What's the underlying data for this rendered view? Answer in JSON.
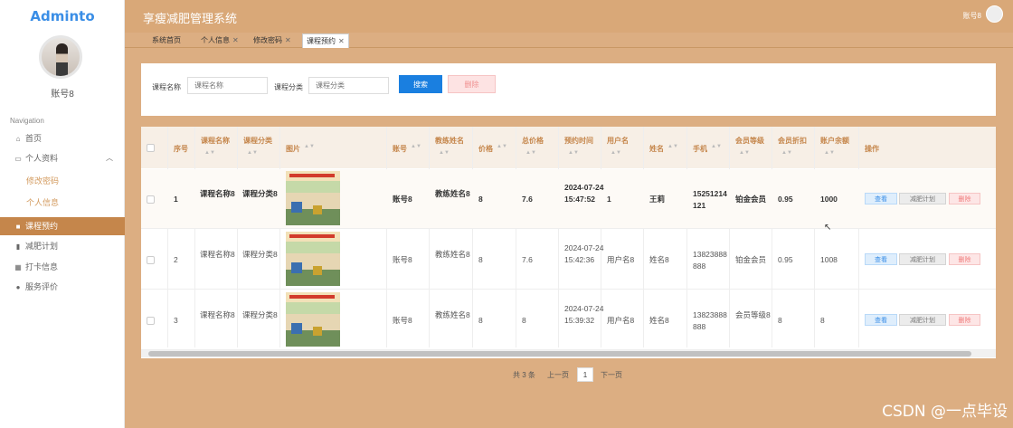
{
  "sidebar": {
    "logo": "Adminto",
    "username": "账号8",
    "nav_title": "Navigation",
    "items": [
      {
        "label": "首页",
        "icon": "home-icon"
      },
      {
        "label": "个人资料",
        "icon": "profile-icon"
      },
      {
        "label": "修改密码"
      },
      {
        "label": "个人信息"
      },
      {
        "label": "课程预约",
        "icon": "course-icon"
      },
      {
        "label": "减肥计划",
        "icon": "chart-icon"
      },
      {
        "label": "打卡信息",
        "icon": "grid-icon"
      },
      {
        "label": "服务评价",
        "icon": "user-icon"
      }
    ]
  },
  "header": {
    "title": "享瘦减肥管理系统",
    "user": "账号8"
  },
  "tabs": [
    {
      "label": "系统首页"
    },
    {
      "label": "个人信息"
    },
    {
      "label": "修改密码"
    },
    {
      "label": "课程预约"
    }
  ],
  "search": {
    "course_name_label": "课程名称",
    "course_name_placeholder": "课程名称",
    "course_type_label": "课程分类",
    "course_type_placeholder": "课程分类",
    "search_button": "搜索",
    "delete_button": "删除"
  },
  "table": {
    "headers": [
      "序号",
      "课程名称",
      "课程分类",
      "图片",
      "账号",
      "教练姓名",
      "价格",
      "总价格",
      "预约时间",
      "用户名",
      "姓名",
      "手机",
      "会员等级",
      "会员折扣",
      "账户余额",
      "操作"
    ],
    "rows": [
      {
        "idx": "1",
        "course": "课程名称8",
        "type": "课程分类8",
        "account": "账号8",
        "coach": "教练姓名8",
        "price": "8",
        "total": "7.6",
        "time": "2024-07-24 15:47:52",
        "uname": "1",
        "name": "王莉",
        "phone": "15251214121",
        "level": "铂金会员",
        "discount": "0.95",
        "balance": "1000"
      },
      {
        "idx": "2",
        "course": "课程名称8",
        "type": "课程分类8",
        "account": "账号8",
        "coach": "教练姓名8",
        "price": "8",
        "total": "7.6",
        "time": "2024-07-24 15:42:36",
        "uname": "用户名8",
        "name": "姓名8",
        "phone": "13823888888",
        "level": "铂金会员",
        "discount": "0.95",
        "balance": "1008"
      },
      {
        "idx": "3",
        "course": "课程名称8",
        "type": "课程分类8",
        "account": "账号8",
        "coach": "教练姓名8",
        "price": "8",
        "total": "8",
        "time": "2024-07-24 15:39:32",
        "uname": "用户名8",
        "name": "姓名8",
        "phone": "13823888888",
        "level": "会员等级8",
        "discount": "8",
        "balance": "8"
      }
    ],
    "actions": {
      "view": "查看",
      "plan": "减肥计划",
      "delete": "删除"
    }
  },
  "pagination": {
    "total": "共 3 条",
    "prev": "上一页",
    "page": "1",
    "next": "下一页"
  },
  "watermark": "CSDN @一点毕设"
}
